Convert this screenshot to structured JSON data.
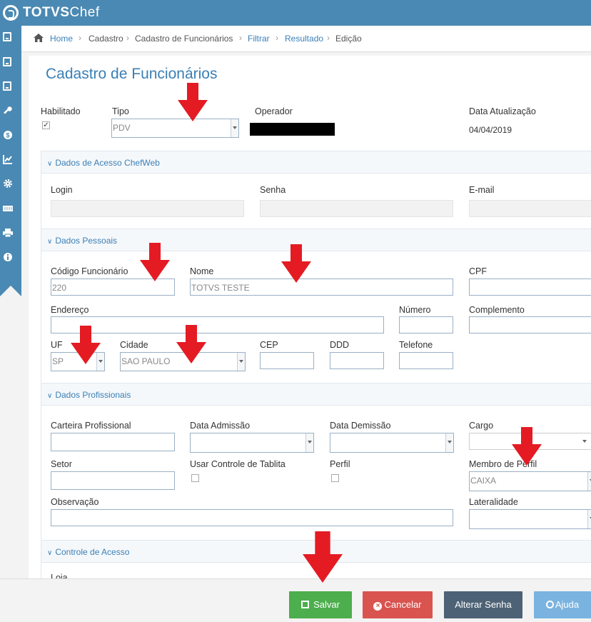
{
  "header": {
    "brand_bold": "TOTVS",
    "brand_light": "Chef"
  },
  "breadcrumb": {
    "home": "Home",
    "cadastro": "Cadastro",
    "cadastro_funcionarios": "Cadastro de Funcionários",
    "filtrar": "Filtrar",
    "resultado": "Resultado",
    "edicao": "Edição"
  },
  "page_title": "Cadastro de Funcionários",
  "top_fields": {
    "habilitado_label": "Habilitado",
    "habilitado_checked": "✓",
    "tipo_label": "Tipo",
    "tipo_value": "PDV",
    "operador_label": "Operador",
    "data_atualizacao_label": "Data Atualização",
    "data_atualizacao_value": "04/04/2019"
  },
  "sections": {
    "acesso": "Dados de Acesso ChefWeb",
    "pessoais": "Dados Pessoais",
    "profissionais": "Dados Profissionais",
    "controle": "Controle de Acesso"
  },
  "acesso": {
    "login": "Login",
    "senha": "Senha",
    "email": "E-mail"
  },
  "pessoais": {
    "codigo_label": "Código Funcionário",
    "codigo_value": "220",
    "nome_label": "Nome",
    "nome_value": "TOTVS TESTE",
    "cpf_label": "CPF",
    "endereco_label": "Endereço",
    "numero_label": "Número",
    "complemento_label": "Complemento",
    "uf_label": "UF",
    "uf_value": "SP",
    "cidade_label": "Cidade",
    "cidade_value": "SAO PAULO",
    "cep_label": "CEP",
    "ddd_label": "DDD",
    "telefone_label": "Telefone"
  },
  "profissionais": {
    "carteira_label": "Carteira Profissional",
    "admissao_label": "Data Admissão",
    "demissao_label": "Data Demissão",
    "cargo_label": "Cargo",
    "setor_label": "Setor",
    "tablita_label": "Usar Controle de Tablita",
    "perfil_label": "Perfil",
    "membro_label": "Membro de Perfil",
    "membro_value": "CAIXA",
    "observacao_label": "Observação",
    "lateralidade_label": "Lateralidade"
  },
  "controle": {
    "loja_label": "Loja"
  },
  "buttons": {
    "salvar": "Salvar",
    "cancelar": "Cancelar",
    "alterar_senha": "Alterar Senha",
    "ajuda": "Ajuda"
  },
  "colors": {
    "brand": "#4a89b3",
    "link": "#3a7fb5",
    "save": "#4cae4c",
    "cancel": "#d9534f",
    "alter": "#4d6275",
    "help": "#7ab3e0",
    "arrow": "#e41b23"
  },
  "icons": [
    "home-icon",
    "book-icon",
    "key-icon",
    "dollar-icon",
    "chart-icon",
    "gear-icon",
    "keyboard-icon",
    "printer-icon",
    "info-icon",
    "floppy-icon",
    "x-circle-icon",
    "question-circle-icon",
    "arrow-down-icon"
  ]
}
